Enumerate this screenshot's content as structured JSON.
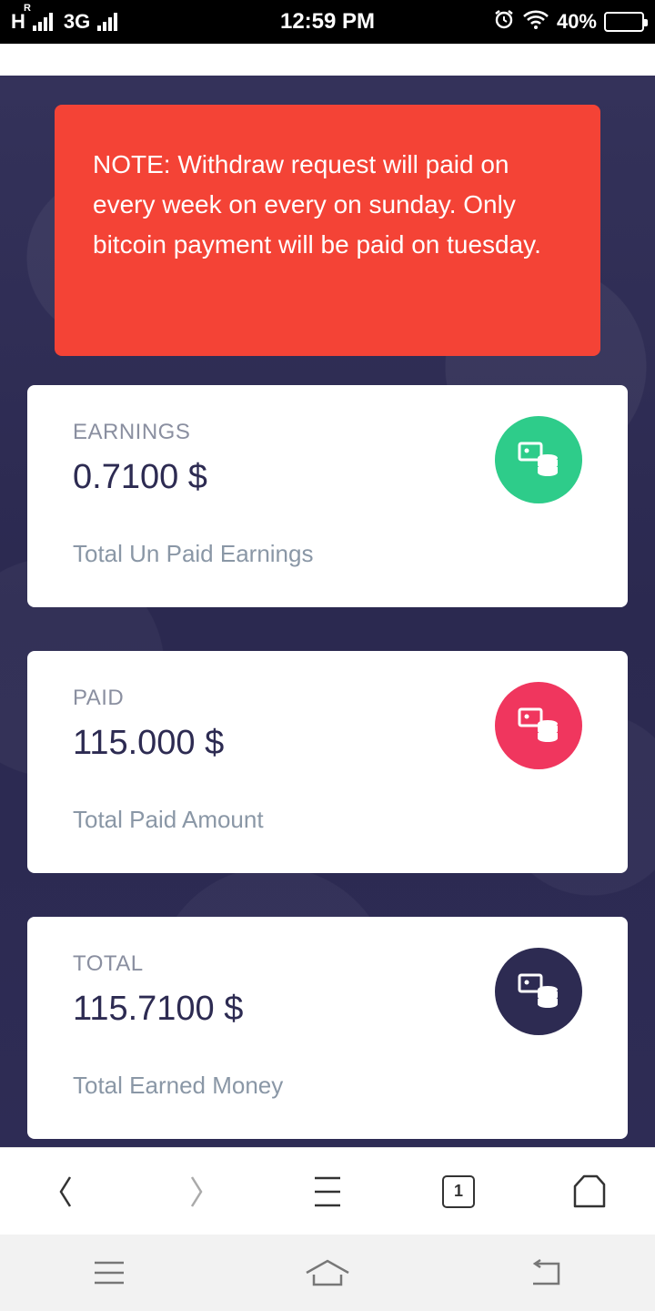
{
  "status_bar": {
    "network_label": "H",
    "roaming_label": "R",
    "network2_label": "3G",
    "time": "12:59 PM",
    "battery_percent": "40%",
    "battery_level": 0.4
  },
  "note": {
    "text": "NOTE: Withdraw request will paid on every week on every on sunday. Only bitcoin payment will be paid on tuesday."
  },
  "cards": [
    {
      "label": "EARNINGS",
      "value": "0.7100 $",
      "subtitle": "Total Un Paid Earnings",
      "icon": "money-stack-icon",
      "color": "#2ecc8a"
    },
    {
      "label": "PAID",
      "value": "115.000 $",
      "subtitle": "Total Paid Amount",
      "icon": "money-stack-icon",
      "color": "#f0365e"
    },
    {
      "label": "TOTAL",
      "value": "115.7100 $",
      "subtitle": "Total Earned Money",
      "icon": "money-stack-icon",
      "color": "#2d2b52"
    }
  ],
  "browser_bar": {
    "tab_count": "1",
    "buttons": [
      "back-icon",
      "forward-icon",
      "menu-icon",
      "tabs-icon",
      "home-icon"
    ]
  },
  "android_nav": {
    "buttons": [
      "recent-apps-icon",
      "home-icon",
      "back-icon"
    ]
  }
}
